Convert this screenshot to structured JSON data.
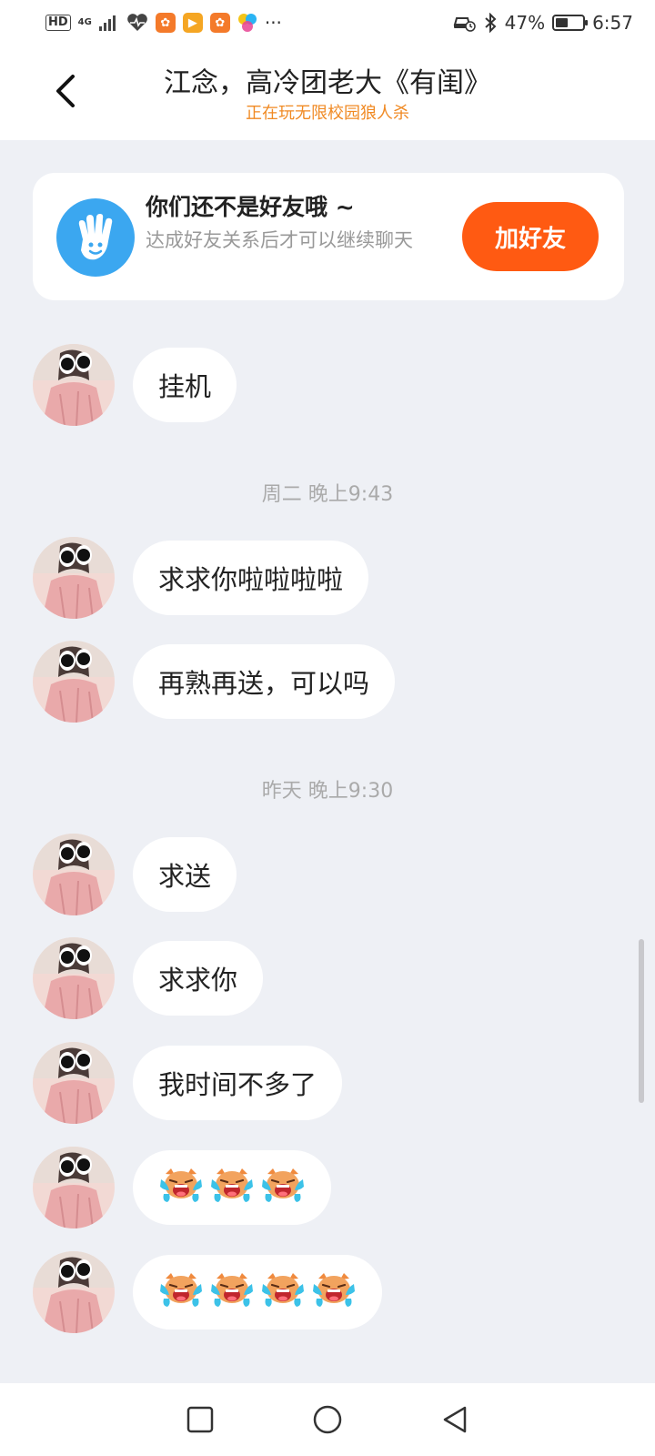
{
  "status_bar": {
    "hd": "HD",
    "network": "4G",
    "more": "···",
    "battery_percent": "47%",
    "battery_level": 0.47,
    "time": "6:57",
    "app_icons": [
      "heart-rate-icon",
      "app-orange-icon",
      "video-app-icon",
      "app-orange-icon-2",
      "colorful-app-icon"
    ]
  },
  "header": {
    "title": "江念，高冷团老大《有闺》",
    "subtitle": "正在玩无限校园狼人杀"
  },
  "friend_card": {
    "title": "你们还不是好友哦 ~",
    "description": "达成好友关系后才可以继续聊天",
    "button_label": "加好友"
  },
  "messages": [
    {
      "type": "text",
      "text": "挂机"
    },
    {
      "type": "time",
      "text": "周二 晚上9:43"
    },
    {
      "type": "text",
      "text": "求求你啦啦啦啦"
    },
    {
      "type": "text",
      "text": "再熟再送，可以吗"
    },
    {
      "type": "time",
      "text": "昨天 晚上9:30"
    },
    {
      "type": "text",
      "text": "求送"
    },
    {
      "type": "text",
      "text": "求求你"
    },
    {
      "type": "text",
      "text": "我时间不多了"
    },
    {
      "type": "emoji",
      "count": 3,
      "icon": "crying-face-emoji"
    },
    {
      "type": "emoji",
      "count": 4,
      "icon": "crying-face-emoji"
    }
  ],
  "colors": {
    "accent_orange": "#ff5a12",
    "subtitle_orange": "#f08a24",
    "hand_blue": "#3ba7f0",
    "background": "#eef0f5"
  }
}
